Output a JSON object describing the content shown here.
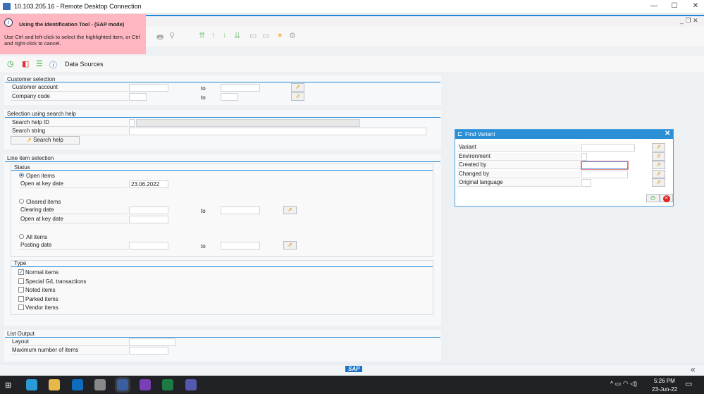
{
  "window": {
    "title": "10.103.205.16 - Remote Desktop Connection"
  },
  "tooltip": {
    "title": "Using the Identification Tool - (SAP mode)",
    "body": "Use Ctrl and left-click to select the highlighted item, or Ctrl and right-click to cancel."
  },
  "app_toolbar": {
    "data_sources": "Data Sources"
  },
  "customer_selection": {
    "title": "Customer selection",
    "rows": [
      {
        "label": "Customer account",
        "to": "to"
      },
      {
        "label": "Company code",
        "to": "to"
      }
    ]
  },
  "search_help": {
    "title": "Selection using search help",
    "id_label": "Search help ID",
    "string_label": "Search string",
    "button": "Search help"
  },
  "line_item": {
    "title": "Line item selection",
    "status_title": "Status",
    "open_items": "Open items",
    "open_key_date": "Open at key date",
    "open_key_date_value": "23.06.2022",
    "cleared_items": "Cleared items",
    "clearing_date": "Clearing date",
    "to": "to",
    "open_key_date2": "Open at key date",
    "all_items": "All items",
    "posting_date": "Posting date",
    "selected_status": "Open items"
  },
  "type": {
    "title": "Type",
    "items": [
      {
        "label": "Normal items",
        "checked": true
      },
      {
        "label": "Special G/L transactions",
        "checked": false
      },
      {
        "label": "Noted items",
        "checked": false
      },
      {
        "label": "Parked items",
        "checked": false
      },
      {
        "label": "Vendor items",
        "checked": false
      }
    ]
  },
  "list_output": {
    "title": "List Output",
    "layout": "Layout",
    "max_items": "Maximum number of items"
  },
  "dialog": {
    "title": "Find Variant",
    "fields": [
      "Variant",
      "Environment",
      "Created by",
      "Changed by",
      "Original language"
    ]
  },
  "taskbar": {
    "time": "5:26 PM",
    "date": "23-Jun-22"
  },
  "colors": {
    "accent": "#1e88d8",
    "tooltip": "#ffb6c1",
    "dialog_header": "#2b8fd6"
  }
}
